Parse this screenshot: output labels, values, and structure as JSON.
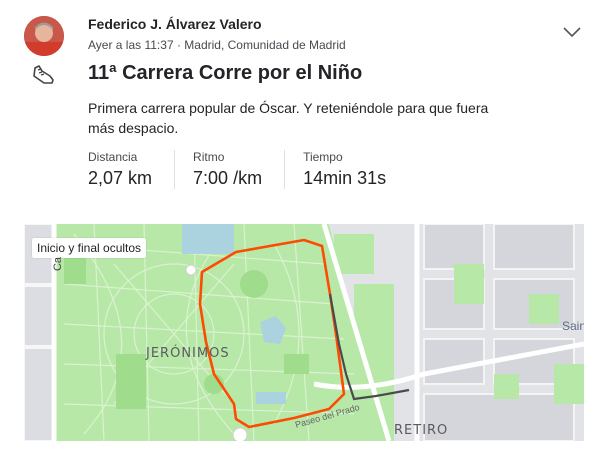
{
  "athlete": {
    "name": "Federico J. Álvarez Valero"
  },
  "activity": {
    "meta": "Ayer a las 11:37 · Madrid, Comunidad de Madrid",
    "sport_icon": "running-shoe-icon",
    "title": "11ª Carrera Corre por el Niño",
    "description": "Primera carrera popular de Óscar. Y reteniéndole para que fuera más despacio."
  },
  "stats": [
    {
      "label": "Distancia",
      "value": "2,07 km"
    },
    {
      "label": "Ritmo",
      "value": "7:00 /km"
    },
    {
      "label": "Tiempo",
      "value": "14min 31s"
    }
  ],
  "map": {
    "badge": "Inicio y final ocultos",
    "labels": {
      "jeronimos": "JERÓNIMOS",
      "retiro": "RETIRO",
      "street": "Paseo del Prado",
      "street_left": "Ca",
      "sain": "Sain"
    },
    "colors": {
      "route": "#fc4c02",
      "hidden_route": "#4a4a4f",
      "park": "#b8e8a8",
      "water": "#aad3df"
    }
  }
}
